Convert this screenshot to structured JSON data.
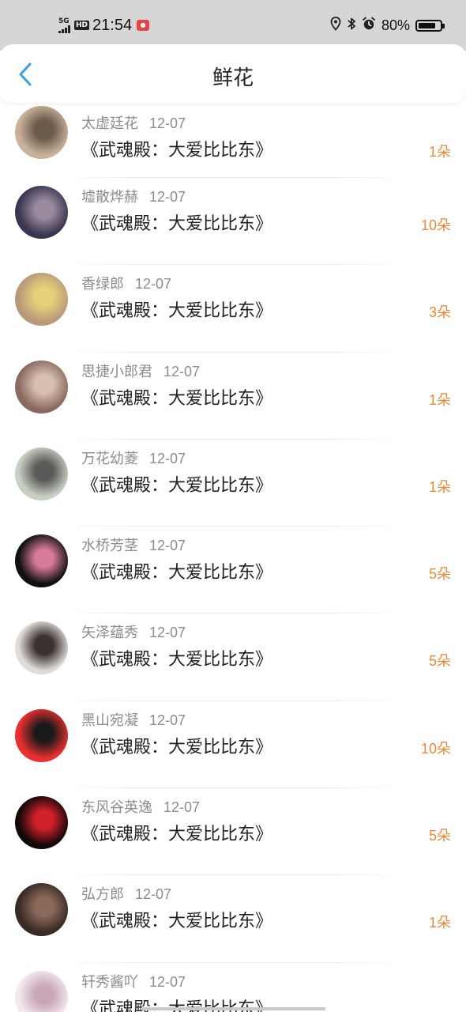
{
  "status_bar": {
    "network": "5G",
    "hd": "HD",
    "time": "21:54",
    "battery": "80%",
    "battery_level": 0.8
  },
  "header": {
    "title": "鲜花"
  },
  "entries": [
    {
      "name": "太虚廷花",
      "date": "12-07",
      "book": "《武魂殿：大爱比比东》",
      "flowers": "1朵",
      "avatar_colors": [
        "#c9b29a",
        "#6b5a4a"
      ]
    },
    {
      "name": "墟散烨赫",
      "date": "12-07",
      "book": "《武魂殿：大爱比比东》",
      "flowers": "10朵",
      "avatar_colors": [
        "#3a3550",
        "#9a8a9e"
      ]
    },
    {
      "name": "香绿郎",
      "date": "12-07",
      "book": "《武魂殿：大爱比比东》",
      "flowers": "3朵",
      "avatar_colors": [
        "#b89a7a",
        "#e8d078"
      ]
    },
    {
      "name": "思捷小郎君",
      "date": "12-07",
      "book": "《武魂殿：大爱比比东》",
      "flowers": "1朵",
      "avatar_colors": [
        "#8a6a60",
        "#d8c0b0"
      ]
    },
    {
      "name": "万花幼菱",
      "date": "12-07",
      "book": "《武魂殿：大爱比比东》",
      "flowers": "1朵",
      "avatar_colors": [
        "#c8cfc4",
        "#5a5a58"
      ]
    },
    {
      "name": "水桥芳茎",
      "date": "12-07",
      "book": "《武魂殿：大爱比比东》",
      "flowers": "5朵",
      "avatar_colors": [
        "#101010",
        "#d87a9a"
      ]
    },
    {
      "name": "矢泽蕴秀",
      "date": "12-07",
      "book": "《武魂殿：大爱比比东》",
      "flowers": "5朵",
      "avatar_colors": [
        "#e0dcd8",
        "#3a3230"
      ]
    },
    {
      "name": "黑山宛凝",
      "date": "12-07",
      "book": "《武魂殿：大爱比比东》",
      "flowers": "10朵",
      "avatar_colors": [
        "#e83030",
        "#1a1a1a"
      ]
    },
    {
      "name": "东风谷英逸",
      "date": "12-07",
      "book": "《武魂殿：大爱比比东》",
      "flowers": "5朵",
      "avatar_colors": [
        "#120808",
        "#d0202a"
      ]
    },
    {
      "name": "弘方郎",
      "date": "12-07",
      "book": "《武魂殿：大爱比比东》",
      "flowers": "1朵",
      "avatar_colors": [
        "#3a2a24",
        "#8a6a5a"
      ]
    },
    {
      "name": "轩秀酱吖",
      "date": "12-07",
      "book": "《武魂殿：大爱比比东》",
      "flowers": "",
      "avatar_colors": [
        "#f4e8ee",
        "#c8a8b8"
      ]
    }
  ],
  "colors": {
    "accent_back": "#3a9ee8",
    "flower_count": "#e8893a",
    "name_gray": "#8c8c8c",
    "title_dark": "#222222"
  },
  "icons": {
    "back": "back-arrow-icon",
    "location": "location-icon",
    "bluetooth": "bluetooth-icon",
    "alarm": "alarm-icon",
    "battery": "battery-icon"
  }
}
